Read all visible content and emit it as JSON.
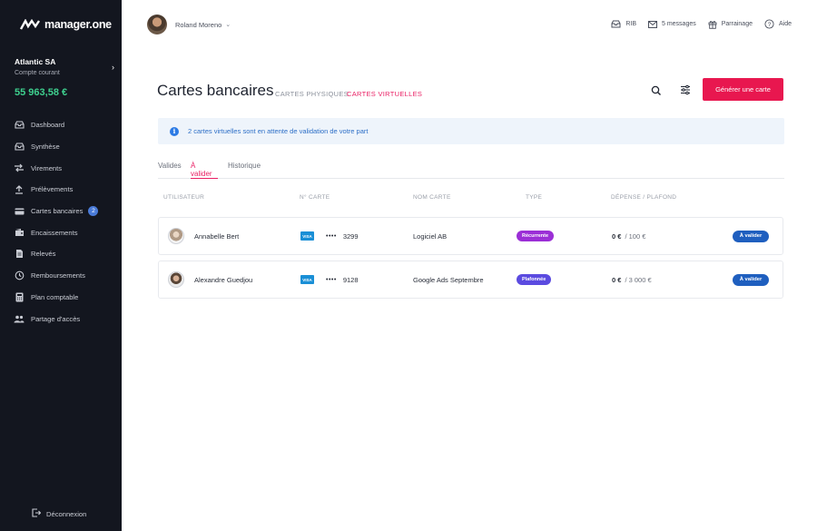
{
  "app": {
    "logo_text": "manager.one"
  },
  "account": {
    "name": "Atlantic SA",
    "type": "Compte courant",
    "balance": "55 963,58 €"
  },
  "sidebar": {
    "items": [
      {
        "label": "Dashboard",
        "icon": "inbox-icon"
      },
      {
        "label": "Synthèse",
        "icon": "inbox-icon"
      },
      {
        "label": "Virements",
        "icon": "transfer-icon"
      },
      {
        "label": "Prélèvements",
        "icon": "upload-icon"
      },
      {
        "label": "Cartes bancaires",
        "icon": "card-icon",
        "badge": "2"
      },
      {
        "label": "Encaissements",
        "icon": "wallet-icon"
      },
      {
        "label": "Relevés",
        "icon": "document-icon"
      },
      {
        "label": "Remboursements",
        "icon": "refund-icon"
      },
      {
        "label": "Plan comptable",
        "icon": "calculator-icon"
      },
      {
        "label": "Partage d'accès",
        "icon": "users-icon"
      }
    ],
    "logout": "Déconnexion"
  },
  "topbar": {
    "user_name": "Roland Moreno",
    "rib": "RIB",
    "messages": "5 messages",
    "parrainage": "Parrainage",
    "aide": "Aide"
  },
  "page": {
    "title": "Cartes bancaires",
    "tab_physical": "CARTES PHYSIQUES",
    "tab_virtual": "CARTES VIRTUELLES",
    "generate_button": "Générer une carte"
  },
  "alert": {
    "text": "2 cartes virtuelles sont en attente de validation de votre part"
  },
  "subtabs": {
    "valid": "Valides",
    "pending": "À valider",
    "history": "Historique"
  },
  "table": {
    "headers": {
      "user": "UTILISATEUR",
      "card_no": "N° CARTE",
      "card_name": "NOM CARTE",
      "type": "TYPE",
      "spend": "DÉPENSE / PLAFOND"
    },
    "rows": [
      {
        "user": "Annabelle Bert",
        "brand": "VISA",
        "dots": "••••",
        "last4": "3299",
        "card_name": "Logiciel AB",
        "type": "Récurrente",
        "type_color": "#9b2fd6",
        "spent": "0 €",
        "limit": "/ 100 €",
        "action": "À valider"
      },
      {
        "user": "Alexandre Guedjou",
        "brand": "VISA",
        "dots": "••••",
        "last4": "9128",
        "card_name": "Google Ads Septembre",
        "type": "Plafonnée",
        "type_color": "#5b4be0",
        "spent": "0 €",
        "limit": "/ 3 000 €",
        "action": "À valider"
      }
    ]
  },
  "colors": {
    "accent": "#e8174f",
    "sidebar_bg": "#13161f",
    "balance": "#3ecf8e",
    "info": "#2d7be5"
  }
}
